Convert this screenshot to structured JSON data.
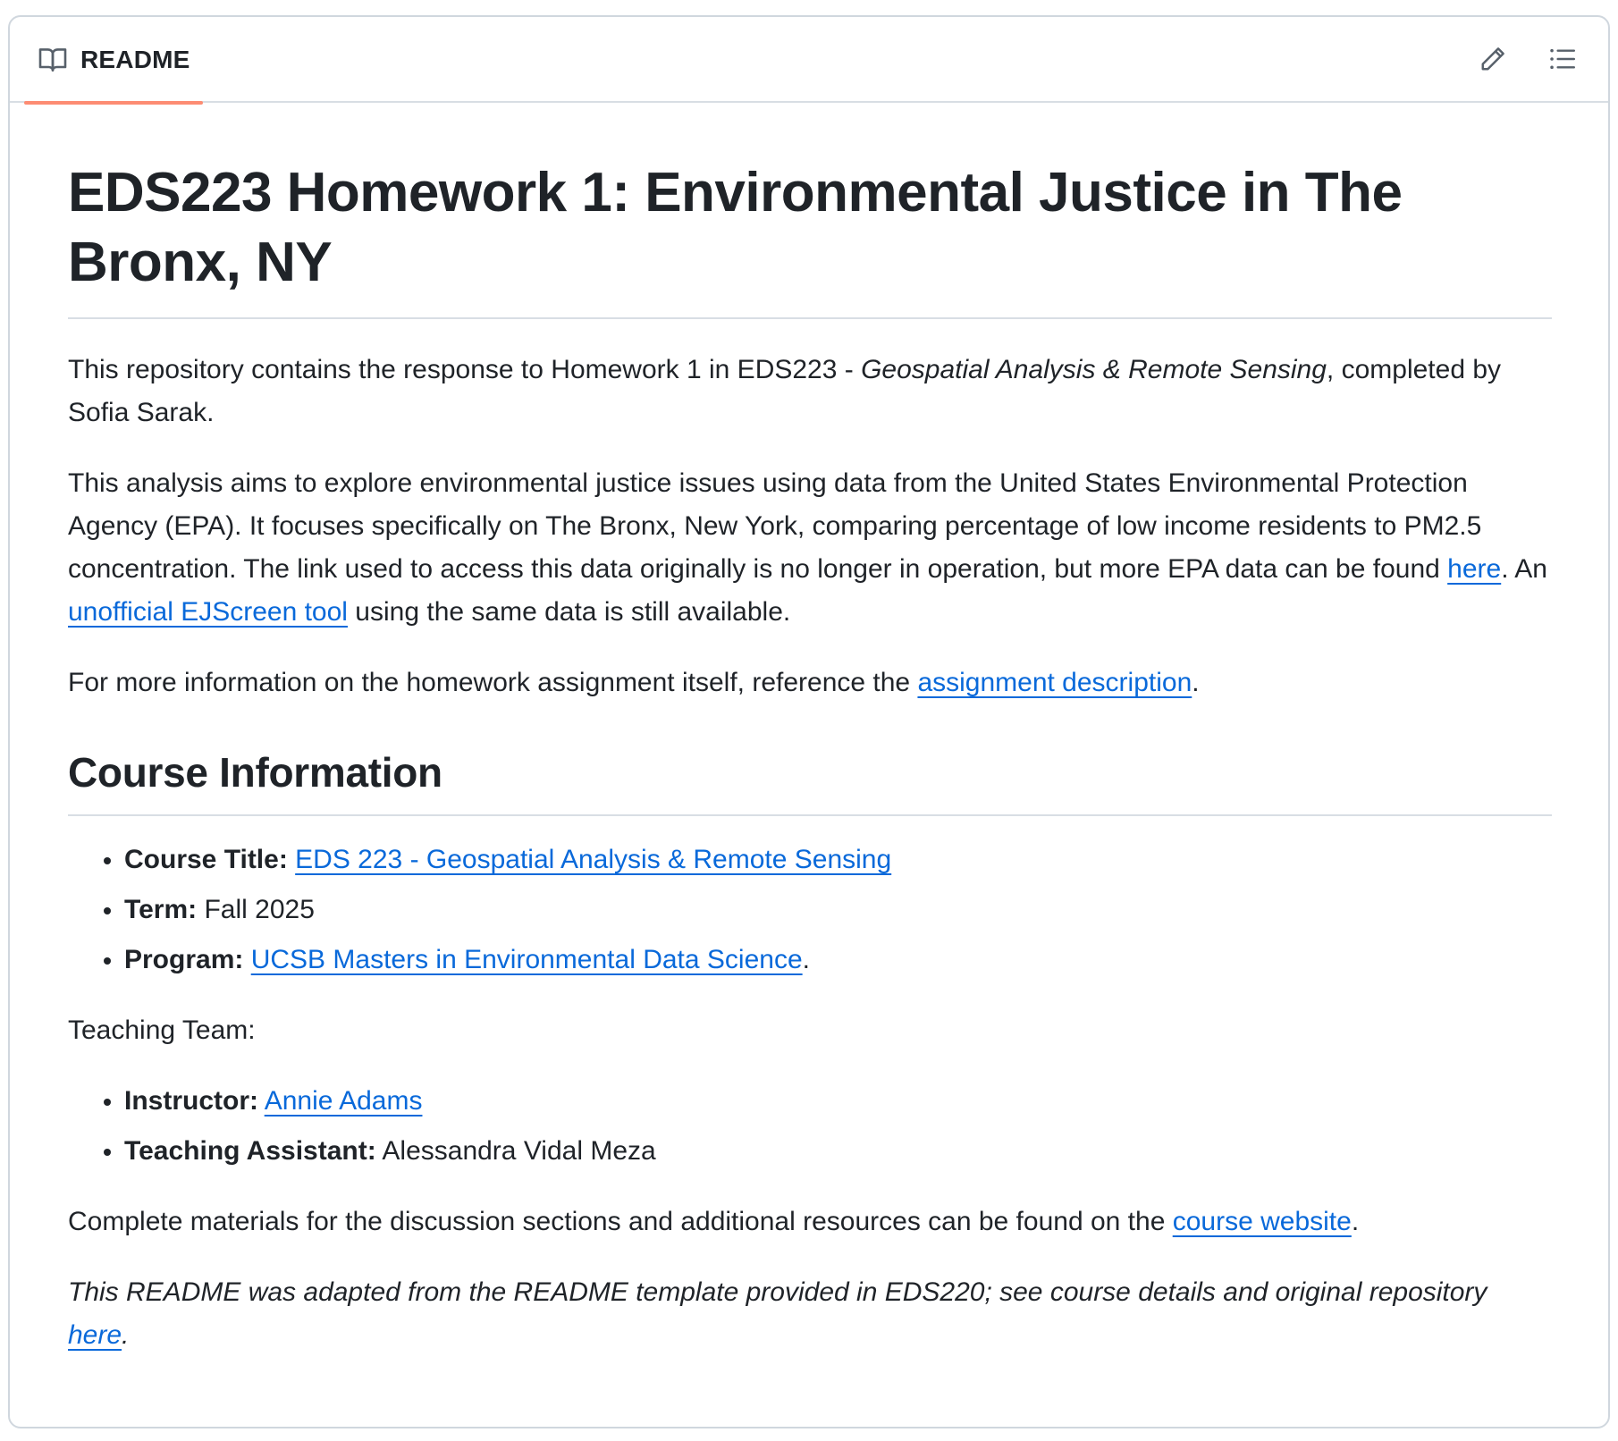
{
  "header": {
    "tab_label": "README",
    "tab_icon": "book-icon",
    "edit_icon": "pencil-icon",
    "outline_icon": "list-unordered-icon",
    "accent_color": "#fd8c73"
  },
  "readme": {
    "title": "EDS223 Homework 1: Environmental Justice in The Bronx, NY",
    "intro": {
      "text1": "This repository contains the response to Homework 1 in EDS223 - ",
      "course_italic": "Geospatial Analysis & Remote Sensing",
      "text2": ", completed by Sofia Sarak."
    },
    "analysis": {
      "text1": "This analysis aims to explore environmental justice issues using data from the United States Environmental Protection Agency (EPA). It focuses specifically on The Bronx, New York, comparing percentage of low income residents to PM2.5 concentration. The link used to access this data originally is no longer in operation, but more EPA data can be found ",
      "link1": "here",
      "text2": ". An ",
      "link2": "unofficial EJScreen tool",
      "text3": " using the same data is still available."
    },
    "more_info": {
      "text1": "For more information on the homework assignment itself, reference the ",
      "link": "assignment description",
      "text2": "."
    },
    "course_heading": "Course Information",
    "course_items": [
      {
        "label": "Course Title:",
        "link": "EDS 223 - Geospatial Analysis & Remote Sensing",
        "after": ""
      },
      {
        "label": "Term:",
        "value": " Fall 2025"
      },
      {
        "label": "Program:",
        "link": "UCSB Masters in Environmental Data Science",
        "after": "."
      }
    ],
    "teaching_team_label": "Teaching Team:",
    "team_items": [
      {
        "label": "Instructor:",
        "link": "Annie Adams"
      },
      {
        "label": "Teaching Assistant:",
        "value": " Alessandra Vidal Meza"
      }
    ],
    "materials": {
      "text1": "Complete materials for the discussion sections and additional resources can be found on the ",
      "link": "course website",
      "text2": "."
    },
    "adapted": {
      "text1": "This README was adapted from the README template provided in EDS220; see course details and original repository ",
      "link": "here",
      "text2": "."
    }
  }
}
